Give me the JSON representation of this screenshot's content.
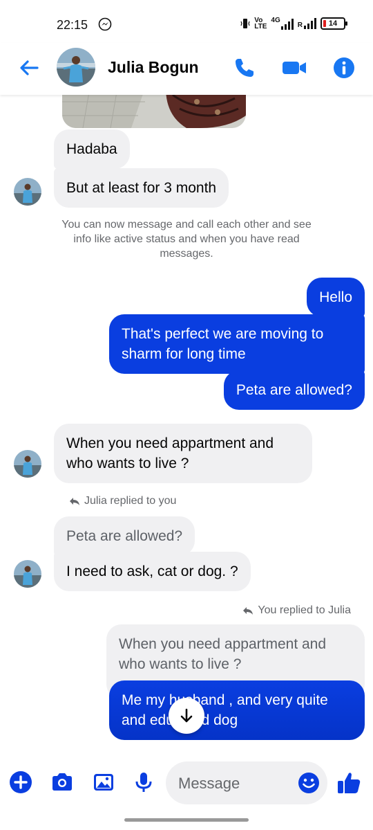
{
  "status": {
    "time": "22:15",
    "network_vo": "Vo",
    "network_lte": "LTE",
    "network_4g": "4G",
    "roaming": "R",
    "battery": "14"
  },
  "header": {
    "contact_name": "Julia Bogun"
  },
  "messages": {
    "m1": "Hadaba",
    "m2": "But at least for 3 month",
    "system_notice": "You can now message and call each other and see info like active status and when you have read messages.",
    "m3": "Hello",
    "m4": "That's perfect we are moving to sharm for long time",
    "m5": "Peta are allowed?",
    "m6": "When you need appartment and who wants to live ?",
    "reply_label_1": "Julia replied to you",
    "m7_quote": "Peta are allowed?",
    "m7": "I need to ask, cat or dog. ?",
    "reply_label_2": "You replied to Julia",
    "m8_quote": "When you need appartment and who wants to live ?",
    "m8": "Me my husband , and very quite and educated dog"
  },
  "composer": {
    "placeholder": "Message"
  },
  "colors": {
    "accent": "#0a3ee0",
    "header_icon": "#1877f2",
    "incoming_bubble": "#f0f0f2"
  }
}
